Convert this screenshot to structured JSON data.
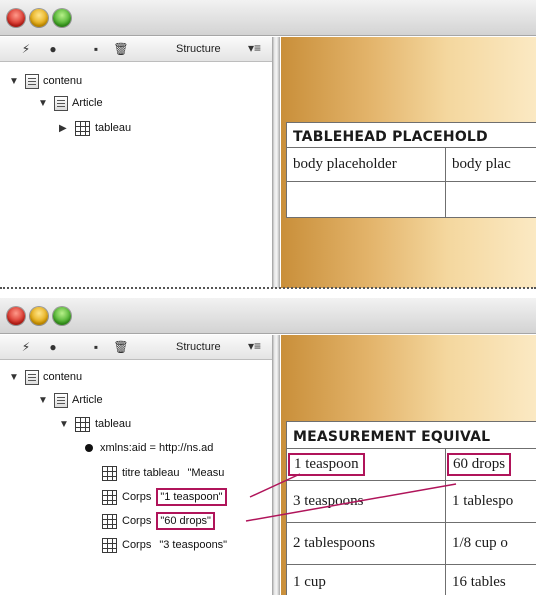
{
  "toolbar": {
    "structure_label": "Structure"
  },
  "icons": {
    "lightning": "⚡",
    "bullet": "●",
    "collapse": "▪",
    "trash": "🗑",
    "menu": "▾≡"
  },
  "top": {
    "tree": {
      "root": "contenu",
      "article": "Article",
      "tableau": "tableau"
    },
    "table": {
      "head": "TABLEHEAD PLACEHOLD",
      "row1": [
        "body placeholder",
        "body plac"
      ],
      "row2": [
        "",
        ""
      ]
    }
  },
  "bottom": {
    "tree": {
      "root": "contenu",
      "article": "Article",
      "tableau": "tableau",
      "attr": "xmlns:aid = http://ns.ad",
      "items": [
        {
          "tag": "titre tableau",
          "value": "\"Measu"
        },
        {
          "tag": "Corps",
          "value": "\"1 teaspoon\""
        },
        {
          "tag": "Corps",
          "value": "\"60 drops\""
        },
        {
          "tag": "Corps",
          "value": "\"3 teaspoons\""
        }
      ]
    },
    "table": {
      "head": "MEASUREMENT EQUIVAL",
      "rows": [
        [
          "1 teaspoon",
          "60 drops"
        ],
        [
          "3 teaspoons",
          "1 tablespo"
        ],
        [
          "2 tablespoons",
          "1/8 cup o"
        ],
        [
          "1 cup",
          "16 tables"
        ]
      ]
    }
  },
  "colors": {
    "highlight": "#b0145a",
    "canvas_gold": "#e3b46b"
  }
}
